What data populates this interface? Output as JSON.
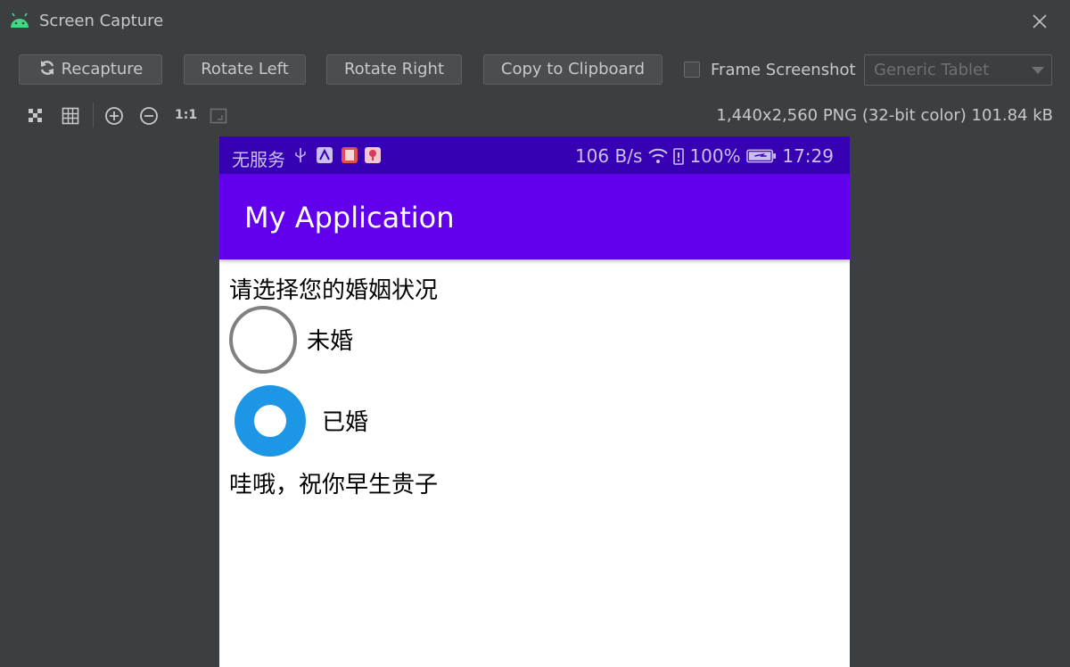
{
  "window": {
    "title": "Screen Capture",
    "icons": [
      "android-icon",
      "close-icon"
    ]
  },
  "toolbar": {
    "recapture_label": "Recapture",
    "rotate_left_label": "Rotate Left",
    "rotate_right_label": "Rotate Right",
    "copy_label": "Copy to Clipboard",
    "frame_screenshot_label": "Frame Screenshot",
    "frame_screenshot_checked": false,
    "device_select_value": "Generic Tablet"
  },
  "view_tools": {
    "icons": [
      "transparency-icon",
      "grid-icon",
      "zoom-in-icon",
      "zoom-out-icon",
      "actual-size-icon",
      "fit-screen-icon"
    ],
    "actual_size_label": "1:1"
  },
  "image_info": "1,440x2,560 PNG (32-bit color) 101.84 kB",
  "phone": {
    "status_bar": {
      "carrier": "无服务",
      "speed": "106 B/s",
      "battery": "100%",
      "time": "17:29",
      "background_color": "#3700b3"
    },
    "app_bar": {
      "title": "My Application",
      "color": "#6200ee"
    },
    "question": "请选择您的婚姻状况",
    "options": [
      {
        "label": "未婚",
        "selected": false
      },
      {
        "label": "已婚",
        "selected": true
      }
    ],
    "result_text": "哇哦，祝你早生贵子",
    "accent_color": "#1e96e6"
  }
}
